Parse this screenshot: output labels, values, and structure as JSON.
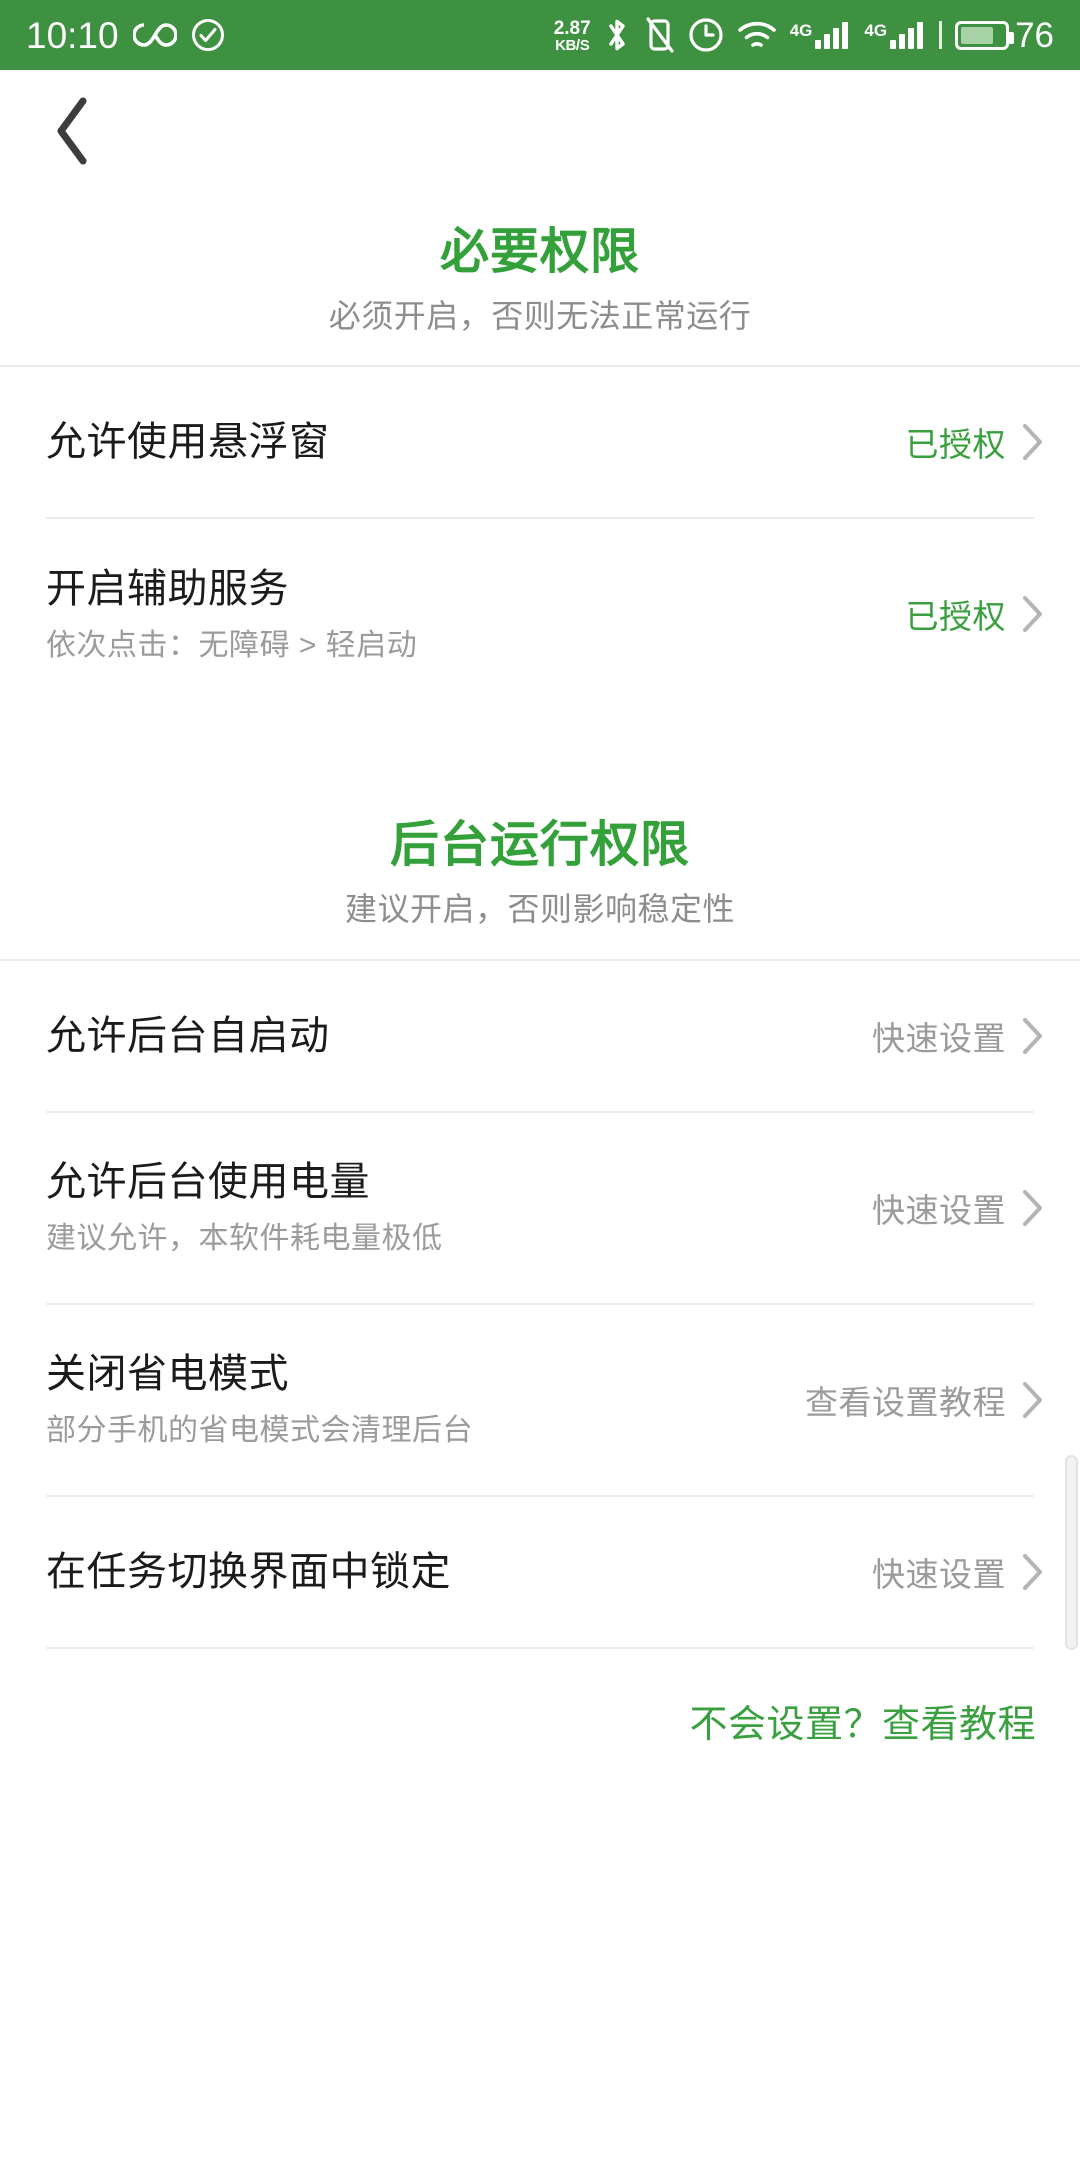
{
  "status_bar": {
    "time": "10:10",
    "left_icons": [
      "infinity-icon",
      "check-circle-icon"
    ],
    "net_speed_value": "2.87",
    "net_speed_unit": "KB/S",
    "right_icons": [
      "bluetooth-icon",
      "vibrate-off-icon",
      "alarm-clock-icon",
      "wifi-icon"
    ],
    "sim1_network": "4G",
    "sim2_network": "4G",
    "battery_percent": "76",
    "bar_color": "#3f9142"
  },
  "nav": {
    "back_label": "back-arrow"
  },
  "sections": [
    {
      "title": "必要权限",
      "subtitle": "必须开启，否则无法正常运行",
      "rows": [
        {
          "title": "允许使用悬浮窗",
          "sub": "",
          "status": "已授权",
          "status_type": "granted"
        },
        {
          "title": "开启辅助服务",
          "sub": "依次点击：无障碍 > 轻启动",
          "status": "已授权",
          "status_type": "granted"
        }
      ]
    },
    {
      "title": "后台运行权限",
      "subtitle": "建议开启，否则影响稳定性",
      "rows": [
        {
          "title": "允许后台自启动",
          "sub": "",
          "status": "快速设置",
          "status_type": "quick"
        },
        {
          "title": "允许后台使用电量",
          "sub": "建议允许，本软件耗电量极低",
          "status": "快速设置",
          "status_type": "quick"
        },
        {
          "title": "关闭省电模式",
          "sub": "部分手机的省电模式会清理后台",
          "status": "查看设置教程",
          "status_type": "quick"
        },
        {
          "title": "在任务切换界面中锁定",
          "sub": "",
          "status": "快速设置",
          "status_type": "quick"
        }
      ]
    }
  ],
  "footer": {
    "help_link": "不会设置？查看教程"
  },
  "colors": {
    "accent_green": "#33a03a",
    "status_bar_green": "#3f9142",
    "muted_gray": "#9b9b9b",
    "title_black": "#1b1b1b"
  }
}
